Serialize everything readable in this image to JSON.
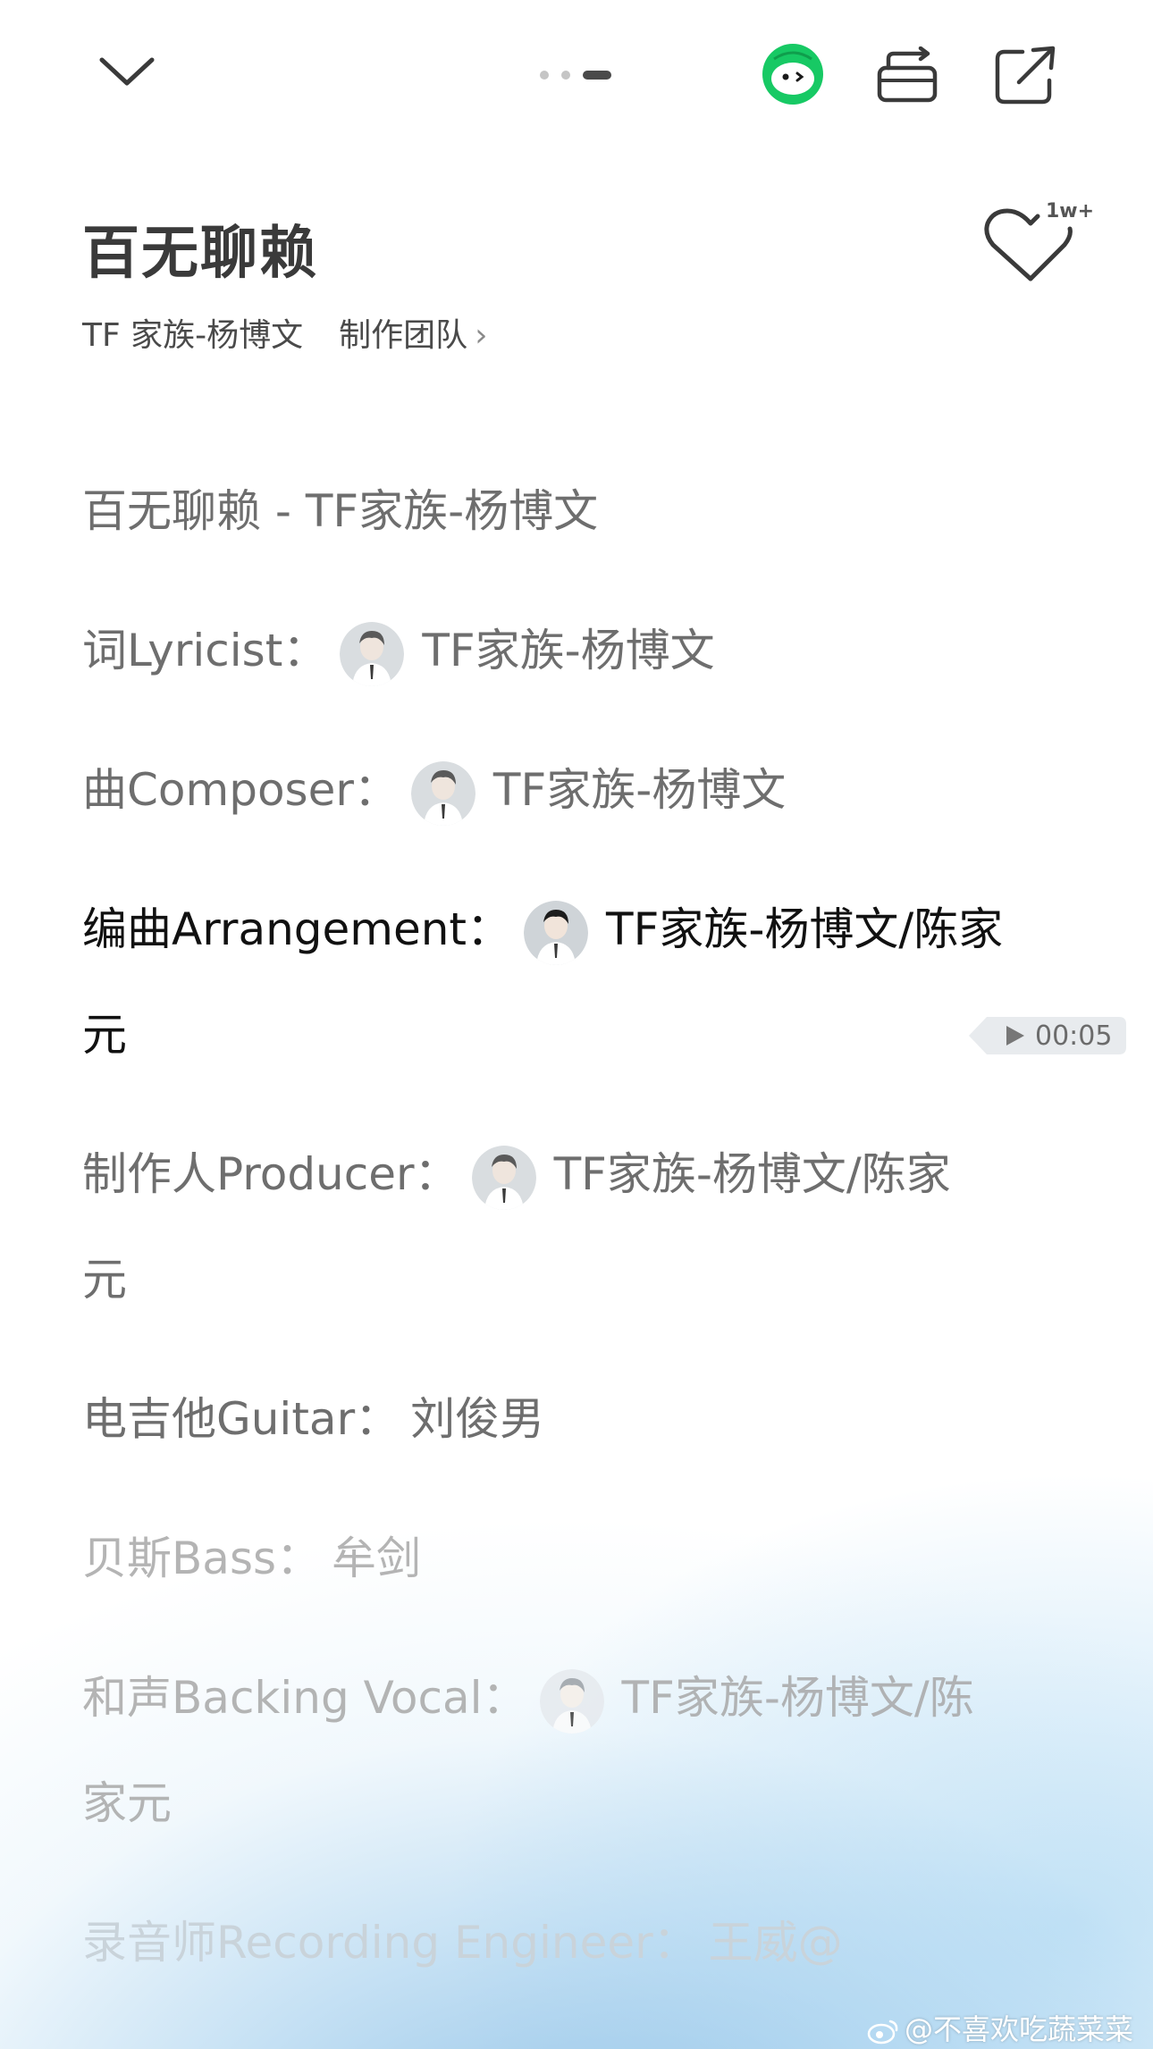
{
  "header": {
    "page_indicator": "page-dots",
    "icons": [
      "chevron-down-icon",
      "mascot-icon",
      "switch-icon",
      "share-icon"
    ]
  },
  "song": {
    "title": "百无聊赖",
    "artist": "TF 家族-杨博文",
    "team_link": "制作团队",
    "like_count": "1w+"
  },
  "lyrics": [
    {
      "label": "百无聊赖 - TF家族-杨博文",
      "names": "",
      "avatar": false,
      "state": "normal"
    },
    {
      "label": "词Lyricist：",
      "names": "TF家族-杨博文",
      "avatar": true,
      "state": "normal"
    },
    {
      "label": "曲Composer：",
      "names": "TF家族-杨博文",
      "avatar": true,
      "state": "normal"
    },
    {
      "label": "编曲Arrangement：",
      "names": "TF家族-杨博文/陈家",
      "names_wrap": "元",
      "avatar": true,
      "state": "active"
    },
    {
      "label": "制作人Producer：",
      "names": "TF家族-杨博文/陈家",
      "names_wrap": "元",
      "avatar": true,
      "state": "normal"
    },
    {
      "label": "电吉他Guitar：",
      "names": "刘俊男",
      "avatar": false,
      "state": "normal"
    },
    {
      "label": "贝斯Bass：",
      "names": "牟剑",
      "avatar": false,
      "state": "fading"
    },
    {
      "label": "和声Backing Vocal：",
      "names": "TF家族-杨博文/陈",
      "names_wrap": "家元",
      "avatar": true,
      "state": "fading"
    },
    {
      "label": "录音师Recording Engineer：",
      "names": "王威@",
      "avatar": false,
      "state": "faded"
    }
  ],
  "playback": {
    "time": "00:05"
  },
  "watermark": {
    "text": "@不喜欢吃蔬菜菜"
  },
  "colors": {
    "active": "#111111",
    "normal": "#6e6e6e",
    "fading": "#a8a8a8",
    "faded": "#c9d3da",
    "accent_green": "#17c964"
  }
}
